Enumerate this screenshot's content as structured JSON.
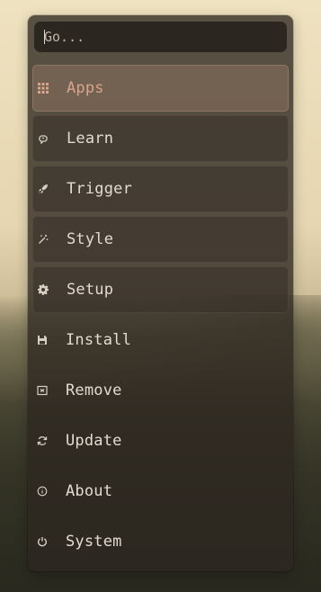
{
  "search": {
    "placeholder": "Go..."
  },
  "menu": {
    "items": [
      {
        "label": "Apps",
        "icon": "grid-icon",
        "selected": true
      },
      {
        "label": "Learn",
        "icon": "brain-icon"
      },
      {
        "label": "Trigger",
        "icon": "rocket-icon"
      },
      {
        "label": "Style",
        "icon": "magic-wand-icon"
      },
      {
        "label": "Setup",
        "icon": "gear-icon"
      },
      {
        "label": "Install",
        "icon": "save-icon"
      },
      {
        "label": "Remove",
        "icon": "remove-icon"
      },
      {
        "label": "Update",
        "icon": "refresh-icon"
      },
      {
        "label": "About",
        "icon": "info-icon"
      },
      {
        "label": "System",
        "icon": "power-icon"
      }
    ]
  },
  "colors": {
    "accent": "#d9a48e",
    "panel": "#2d2620",
    "text": "#e3dbcf"
  }
}
